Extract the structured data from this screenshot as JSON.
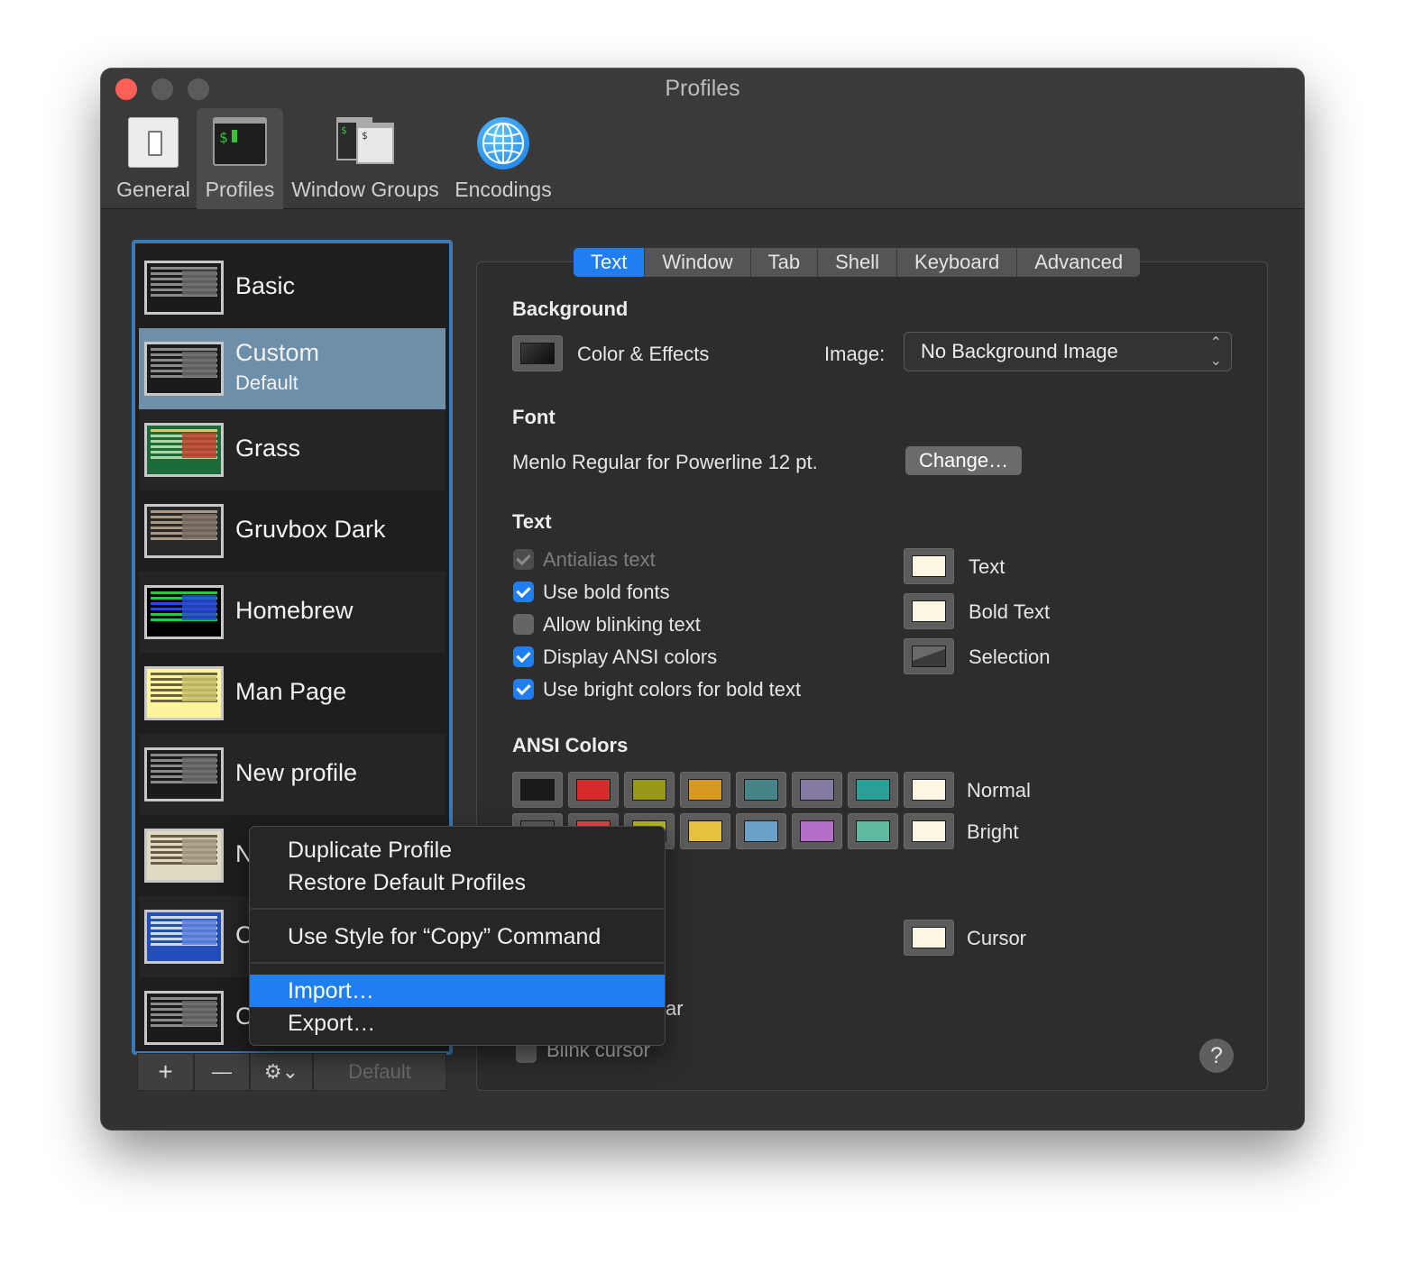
{
  "window": {
    "title": "Profiles"
  },
  "toolbar": {
    "items": [
      {
        "label": "General",
        "icon": "general-switch-icon"
      },
      {
        "label": "Profiles",
        "icon": "terminal-icon",
        "selected": true
      },
      {
        "label": "Window Groups",
        "icon": "window-groups-icon"
      },
      {
        "label": "Encodings",
        "icon": "globe-icon"
      }
    ],
    "term_glyph": "$",
    "groups_glyph_a": "$",
    "groups_glyph_b": "$"
  },
  "profiles": [
    {
      "name": "Basic"
    },
    {
      "name": "Custom",
      "sub": "Default",
      "selected": true
    },
    {
      "name": "Grass"
    },
    {
      "name": "Gruvbox Dark"
    },
    {
      "name": "Homebrew"
    },
    {
      "name": "Man Page"
    },
    {
      "name": "New profile"
    },
    {
      "name": "N"
    },
    {
      "name": "C"
    },
    {
      "name": "C"
    }
  ],
  "list_buttons": {
    "add": "+",
    "remove": "—",
    "gear": "⚙⌄",
    "default": "Default"
  },
  "tabs": [
    "Text",
    "Window",
    "Tab",
    "Shell",
    "Keyboard",
    "Advanced"
  ],
  "background": {
    "heading": "Background",
    "color_effects": "Color & Effects",
    "image_label": "Image:",
    "image_value": "No Background Image"
  },
  "font": {
    "heading": "Font",
    "value": "Menlo Regular for Powerline 12 pt.",
    "change": "Change…"
  },
  "text": {
    "heading": "Text",
    "options": [
      {
        "label": "Antialias text",
        "checked": true,
        "disabled": true
      },
      {
        "label": "Use bold fonts",
        "checked": true
      },
      {
        "label": "Allow blinking text",
        "checked": false
      },
      {
        "label": "Display ANSI colors",
        "checked": true
      },
      {
        "label": "Use bright colors for bold text",
        "checked": true
      }
    ],
    "colors": [
      {
        "label": "Text",
        "color": "#fdf6e3"
      },
      {
        "label": "Bold Text",
        "color": "#fdf6e3"
      },
      {
        "label": "Selection",
        "color": "#3a3a3a"
      }
    ]
  },
  "ansi": {
    "heading": "ANSI Colors",
    "normal_label": "Normal",
    "bright_label": "Bright",
    "normal": [
      "#1a1a1a",
      "#d62b2b",
      "#98971a",
      "#d79921",
      "#458588",
      "#857aa0",
      "#2aa198",
      "#fdf6e3"
    ],
    "bright": [
      "#5a5a5a",
      "#e04848",
      "#b8bb26",
      "#e8c040",
      "#6aa1c8",
      "#b56ec8",
      "#5fb8a0",
      "#fdf6e3"
    ]
  },
  "cursor": {
    "label": "Cursor",
    "color": "#fdf6e3",
    "partial_label": "ar",
    "blink": "Blink cursor"
  },
  "help": "?",
  "context_menu": {
    "items": [
      {
        "label": "Duplicate Profile"
      },
      {
        "label": "Restore Default Profiles"
      },
      {
        "label": "Use Style for “Copy” Command"
      },
      {
        "label": "Import…",
        "highlighted": true
      },
      {
        "label": "Export…"
      }
    ]
  }
}
